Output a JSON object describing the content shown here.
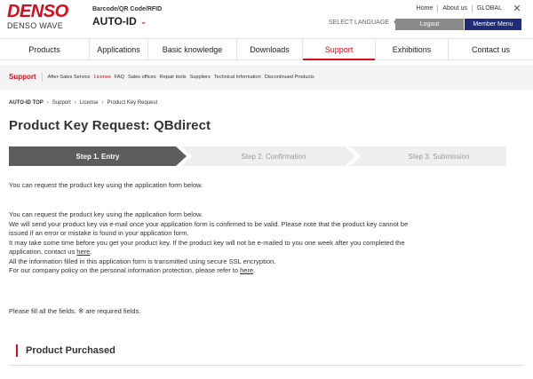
{
  "header": {
    "logo_main": "DENSO",
    "logo_sub": "DENSO WAVE",
    "product_small": "Barcode/QR Code/RFID",
    "product_big": "AUTO-ID",
    "util_links": [
      "Home",
      "About us",
      "GLOBAL"
    ],
    "select_language": "SELECT LANGUAGE",
    "logout_label": "Logout",
    "member_menu_label": "Member Menu"
  },
  "mainnav": {
    "items": [
      "Products",
      "Applications",
      "Basic knowledge",
      "Downloads",
      "Support",
      "Exhibitions",
      "Contact us"
    ],
    "active_index": 4
  },
  "subnav": {
    "title": "Support",
    "items": [
      "After-Sales Service",
      "License",
      "FAQ",
      "Sales offices",
      "Repair tools",
      "Suppliers",
      "Technical Information",
      "Discontinued Products"
    ],
    "active_index": 1
  },
  "breadcrumb": [
    "AUTO-ID TOP",
    "Support",
    "License",
    "Product Key Request"
  ],
  "page_title": "Product Key Request: QBdirect",
  "steps": [
    "Step 1. Entry",
    "Step 2. Confirmation",
    "Step 3. Submission"
  ],
  "intro": "You can request the product key using the application form below.",
  "paragraph": {
    "line1": "You can request the product key using the application form below.",
    "line2": "We will send your product key via e-mail once your application form is confirmed to be valid. Please note that the product key cannot be",
    "line3": "issued if an error or mistake is found in your application form.",
    "line4": "It may take some time before you get your product key. If the product key will not be e-mailed to you one week after you completed the",
    "line5_pre": "application, contact us ",
    "line5_link": "here",
    "line5_post": ".",
    "line6": "All the information filled in this application form is transmitted using secure SSL encryption.",
    "line7_pre": "For our company policy on the personal information protection, please refer to ",
    "line7_link": "here",
    "line7_post": "."
  },
  "fields_note": "Please fill all the fields. ※ are required fields.",
  "section_heading": "Product Purchased",
  "colors": {
    "brand_red": "#dc0a1a",
    "member_navy": "#1f2c78",
    "step_active": "#5c5c5c",
    "step_inactive": "#efefef"
  },
  "icons": {
    "close": "close-icon",
    "product_dropdown": "chevron-down-icon",
    "language_dropdown": "caret-down-icon",
    "breadcrumb_separator": "chevron-right-icon"
  }
}
